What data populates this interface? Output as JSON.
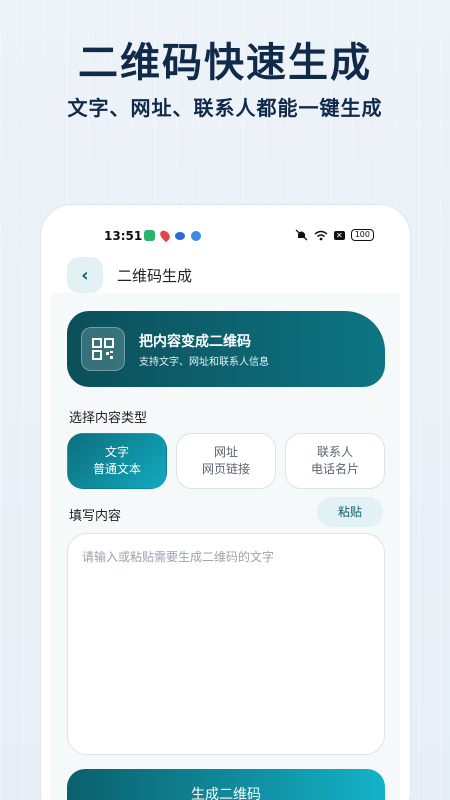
{
  "hero": {
    "title": "二维码快速生成",
    "subtitle": "文字、网址、联系人都能一键生成"
  },
  "status_bar": {
    "time": "13:51",
    "battery": "100",
    "x_badge": "✕"
  },
  "nav": {
    "back_icon": "‹",
    "title": "二维码生成"
  },
  "banner": {
    "title": "把内容变成二维码",
    "subtitle": "支持文字、网址和联系人信息"
  },
  "select_type": {
    "label": "选择内容类型",
    "options": [
      {
        "title": "文字",
        "desc": "普通文本",
        "active": true
      },
      {
        "title": "网址",
        "desc": "网页链接",
        "active": false
      },
      {
        "title": "联系人",
        "desc": "电话名片",
        "active": false
      }
    ]
  },
  "fill": {
    "label": "填写内容",
    "paste_label": "粘贴",
    "placeholder": "请输入或粘贴需要生成二维码的文字"
  },
  "generate_label": "生成二维码",
  "colors": {
    "accent": "#0d7583",
    "accent_light": "#e2f1f3",
    "title_text": "#102a4a"
  }
}
